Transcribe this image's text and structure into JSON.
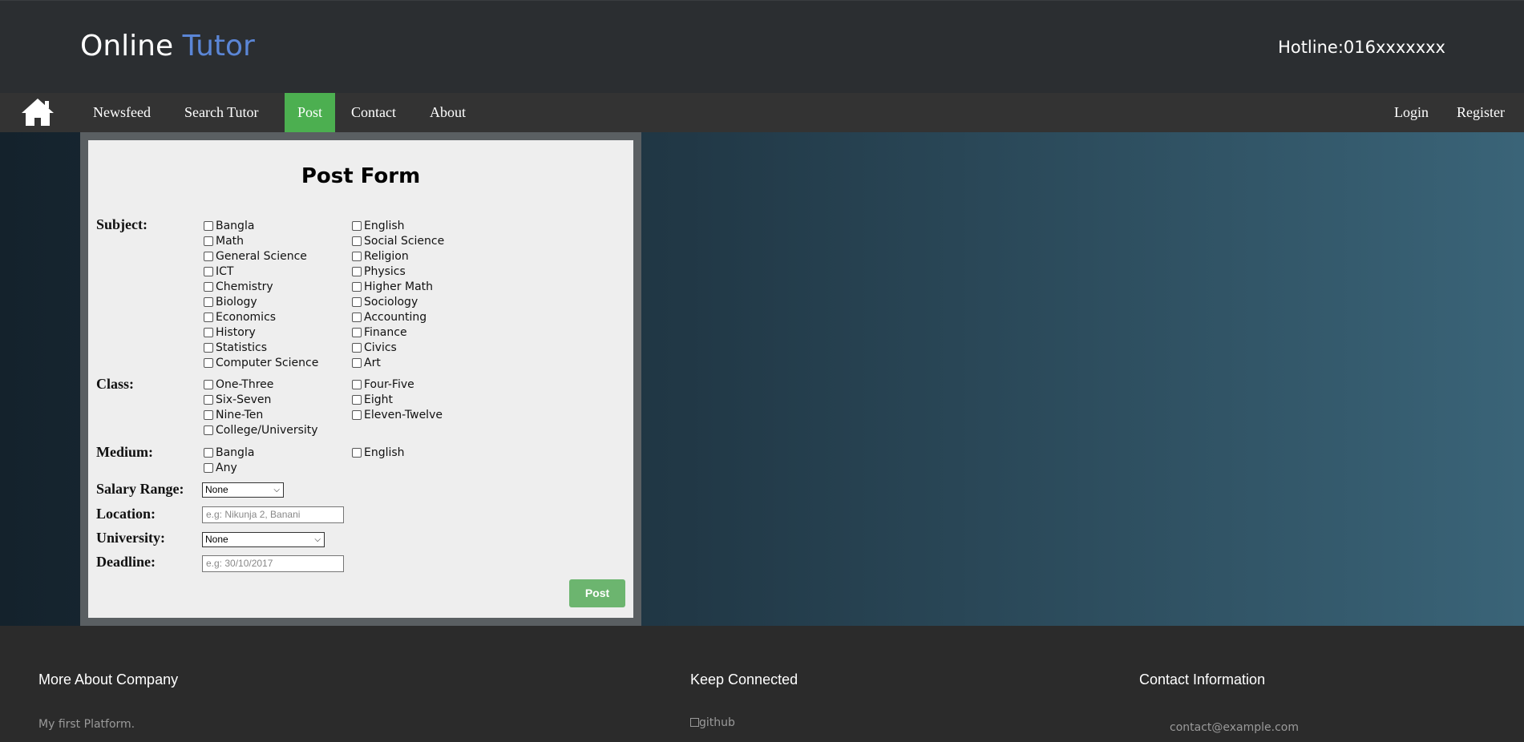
{
  "header": {
    "brand_main": "Online ",
    "brand_accent": "Tutor",
    "hotline": "Hotline:016xxxxxxx",
    "accent_color": "#5b86d6"
  },
  "nav": {
    "home_icon": "home-icon",
    "items": [
      "Newsfeed",
      "Search Tutor",
      "Post",
      "Contact",
      "About"
    ],
    "active": "Post",
    "right": [
      "Login",
      "Register"
    ],
    "active_color": "#4caf50"
  },
  "form": {
    "title": "Post Form",
    "subject_label": "Subject:",
    "subjects_left": [
      "Bangla",
      "Math",
      "General Science",
      "ICT",
      "Chemistry",
      "Biology",
      "Economics",
      "History",
      "Statistics",
      "Computer Science"
    ],
    "subjects_right": [
      "English",
      "Social Science",
      "Religion",
      "Physics",
      "Higher Math",
      "Sociology",
      "Accounting",
      "Finance",
      "Civics",
      "Art"
    ],
    "class_label": "Class:",
    "classes_left": [
      "One-Three",
      "Six-Seven",
      "Nine-Ten",
      "College/University"
    ],
    "classes_right": [
      "Four-Five",
      "Eight",
      "Eleven-Twelve"
    ],
    "medium_label": "Medium:",
    "medium_left": [
      "Bangla",
      "Any"
    ],
    "medium_right": [
      "English"
    ],
    "salary_label": "Salary Range:",
    "salary_value": "None",
    "location_label": "Location:",
    "location_placeholder": "e.g: Nikunja 2, Banani",
    "university_label": "University:",
    "university_value": "None",
    "deadline_label": "Deadline:",
    "deadline_placeholder": "e.g: 30/10/2017",
    "post_button": "Post",
    "button_color": "#6cb56f"
  },
  "footer": {
    "col1_title": "More About Company",
    "col1_text": "My first Platform.",
    "col2_title": "Keep Connected",
    "col2_link": "github",
    "col3_title": "Contact Information",
    "col3_text": "contact@example.com"
  }
}
